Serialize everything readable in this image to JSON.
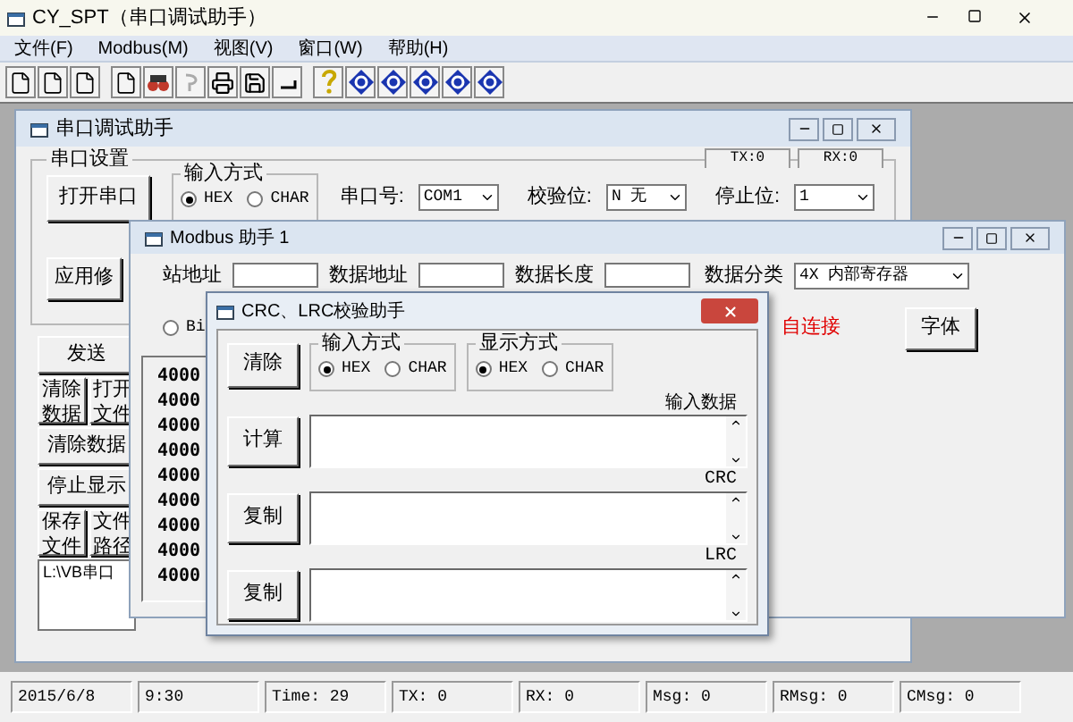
{
  "window": {
    "title": "CY_SPT（串口调试助手）"
  },
  "menu": [
    "文件(F)",
    "Modbus(M)",
    "视图(V)",
    "窗口(W)",
    "帮助(H)"
  ],
  "serial_window": {
    "title": "串口调试助手",
    "group_title": "串口设置",
    "open_button": "打开串口",
    "apply_button": "应用修",
    "input_mode": {
      "title": "输入方式",
      "options": [
        {
          "label": "HEX",
          "selected": true
        },
        {
          "label": "CHAR",
          "selected": false
        }
      ]
    },
    "fields": [
      {
        "label": "串口号:",
        "value": "COM1"
      },
      {
        "label": "校验位:",
        "value": "N 无"
      },
      {
        "label": "停止位:",
        "value": "1"
      }
    ],
    "counters": [
      "TX:0",
      "RX:0"
    ],
    "side_rows": [
      {
        "buttons": [
          "发送"
        ]
      },
      {
        "buttons": [
          "清除数据",
          "打开文件"
        ]
      },
      {
        "buttons": [
          "清除数据"
        ]
      },
      {
        "buttons": [
          "停止显示"
        ]
      },
      {
        "buttons": [
          "保存文件",
          "文件路径"
        ]
      }
    ],
    "path": "L:\\VB串口"
  },
  "modbus_window": {
    "title": "Modbus 助手 1",
    "labels": [
      "站地址",
      "数据地址",
      "数据长度"
    ],
    "category_label": "数据分类",
    "category_value": "4X 内部寄存器",
    "radio": {
      "label": "Bi",
      "selected": false
    },
    "status": "自连接",
    "font_button": "字体",
    "lines": [
      "4000",
      "4000",
      "4000",
      "4000",
      "4000",
      "4000",
      "4000",
      "4000",
      "4000"
    ]
  },
  "crc_window": {
    "title": "CRC、LRC校验助手",
    "clear_button": "清除",
    "groups": [
      {
        "title": "输入方式",
        "options": [
          {
            "label": "HEX",
            "selected": true
          },
          {
            "label": "CHAR",
            "selected": false
          }
        ]
      },
      {
        "title": "显示方式",
        "options": [
          {
            "label": "HEX",
            "selected": true
          },
          {
            "label": "CHAR",
            "selected": false
          }
        ]
      }
    ],
    "sections": [
      {
        "label": "输入数据",
        "button": "计算"
      },
      {
        "label": "CRC",
        "button": "复制"
      },
      {
        "label": "LRC",
        "button": "复制"
      }
    ]
  },
  "status_bar": [
    "2015/6/8",
    "9:30",
    "Time: 29",
    "TX: 0",
    "RX: 0",
    "Msg: 0",
    "RMsg: 0",
    "CMsg: 0"
  ]
}
